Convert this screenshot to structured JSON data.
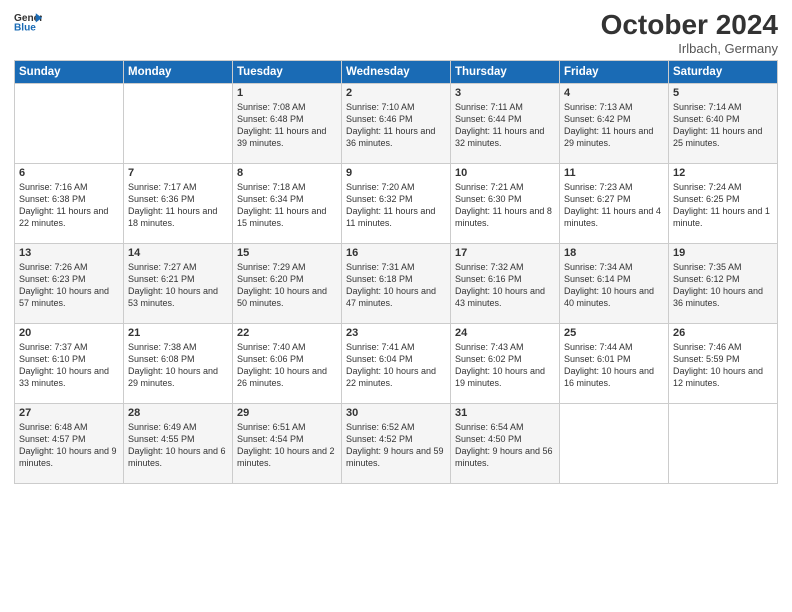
{
  "header": {
    "logo_line1": "General",
    "logo_line2": "Blue",
    "month": "October 2024",
    "location": "Irlbach, Germany"
  },
  "weekdays": [
    "Sunday",
    "Monday",
    "Tuesday",
    "Wednesday",
    "Thursday",
    "Friday",
    "Saturday"
  ],
  "weeks": [
    [
      {
        "day": "",
        "info": ""
      },
      {
        "day": "",
        "info": ""
      },
      {
        "day": "1",
        "info": "Sunrise: 7:08 AM\nSunset: 6:48 PM\nDaylight: 11 hours and 39 minutes."
      },
      {
        "day": "2",
        "info": "Sunrise: 7:10 AM\nSunset: 6:46 PM\nDaylight: 11 hours and 36 minutes."
      },
      {
        "day": "3",
        "info": "Sunrise: 7:11 AM\nSunset: 6:44 PM\nDaylight: 11 hours and 32 minutes."
      },
      {
        "day": "4",
        "info": "Sunrise: 7:13 AM\nSunset: 6:42 PM\nDaylight: 11 hours and 29 minutes."
      },
      {
        "day": "5",
        "info": "Sunrise: 7:14 AM\nSunset: 6:40 PM\nDaylight: 11 hours and 25 minutes."
      }
    ],
    [
      {
        "day": "6",
        "info": "Sunrise: 7:16 AM\nSunset: 6:38 PM\nDaylight: 11 hours and 22 minutes."
      },
      {
        "day": "7",
        "info": "Sunrise: 7:17 AM\nSunset: 6:36 PM\nDaylight: 11 hours and 18 minutes."
      },
      {
        "day": "8",
        "info": "Sunrise: 7:18 AM\nSunset: 6:34 PM\nDaylight: 11 hours and 15 minutes."
      },
      {
        "day": "9",
        "info": "Sunrise: 7:20 AM\nSunset: 6:32 PM\nDaylight: 11 hours and 11 minutes."
      },
      {
        "day": "10",
        "info": "Sunrise: 7:21 AM\nSunset: 6:30 PM\nDaylight: 11 hours and 8 minutes."
      },
      {
        "day": "11",
        "info": "Sunrise: 7:23 AM\nSunset: 6:27 PM\nDaylight: 11 hours and 4 minutes."
      },
      {
        "day": "12",
        "info": "Sunrise: 7:24 AM\nSunset: 6:25 PM\nDaylight: 11 hours and 1 minute."
      }
    ],
    [
      {
        "day": "13",
        "info": "Sunrise: 7:26 AM\nSunset: 6:23 PM\nDaylight: 10 hours and 57 minutes."
      },
      {
        "day": "14",
        "info": "Sunrise: 7:27 AM\nSunset: 6:21 PM\nDaylight: 10 hours and 53 minutes."
      },
      {
        "day": "15",
        "info": "Sunrise: 7:29 AM\nSunset: 6:20 PM\nDaylight: 10 hours and 50 minutes."
      },
      {
        "day": "16",
        "info": "Sunrise: 7:31 AM\nSunset: 6:18 PM\nDaylight: 10 hours and 47 minutes."
      },
      {
        "day": "17",
        "info": "Sunrise: 7:32 AM\nSunset: 6:16 PM\nDaylight: 10 hours and 43 minutes."
      },
      {
        "day": "18",
        "info": "Sunrise: 7:34 AM\nSunset: 6:14 PM\nDaylight: 10 hours and 40 minutes."
      },
      {
        "day": "19",
        "info": "Sunrise: 7:35 AM\nSunset: 6:12 PM\nDaylight: 10 hours and 36 minutes."
      }
    ],
    [
      {
        "day": "20",
        "info": "Sunrise: 7:37 AM\nSunset: 6:10 PM\nDaylight: 10 hours and 33 minutes."
      },
      {
        "day": "21",
        "info": "Sunrise: 7:38 AM\nSunset: 6:08 PM\nDaylight: 10 hours and 29 minutes."
      },
      {
        "day": "22",
        "info": "Sunrise: 7:40 AM\nSunset: 6:06 PM\nDaylight: 10 hours and 26 minutes."
      },
      {
        "day": "23",
        "info": "Sunrise: 7:41 AM\nSunset: 6:04 PM\nDaylight: 10 hours and 22 minutes."
      },
      {
        "day": "24",
        "info": "Sunrise: 7:43 AM\nSunset: 6:02 PM\nDaylight: 10 hours and 19 minutes."
      },
      {
        "day": "25",
        "info": "Sunrise: 7:44 AM\nSunset: 6:01 PM\nDaylight: 10 hours and 16 minutes."
      },
      {
        "day": "26",
        "info": "Sunrise: 7:46 AM\nSunset: 5:59 PM\nDaylight: 10 hours and 12 minutes."
      }
    ],
    [
      {
        "day": "27",
        "info": "Sunrise: 6:48 AM\nSunset: 4:57 PM\nDaylight: 10 hours and 9 minutes."
      },
      {
        "day": "28",
        "info": "Sunrise: 6:49 AM\nSunset: 4:55 PM\nDaylight: 10 hours and 6 minutes."
      },
      {
        "day": "29",
        "info": "Sunrise: 6:51 AM\nSunset: 4:54 PM\nDaylight: 10 hours and 2 minutes."
      },
      {
        "day": "30",
        "info": "Sunrise: 6:52 AM\nSunset: 4:52 PM\nDaylight: 9 hours and 59 minutes."
      },
      {
        "day": "31",
        "info": "Sunrise: 6:54 AM\nSunset: 4:50 PM\nDaylight: 9 hours and 56 minutes."
      },
      {
        "day": "",
        "info": ""
      },
      {
        "day": "",
        "info": ""
      }
    ]
  ]
}
